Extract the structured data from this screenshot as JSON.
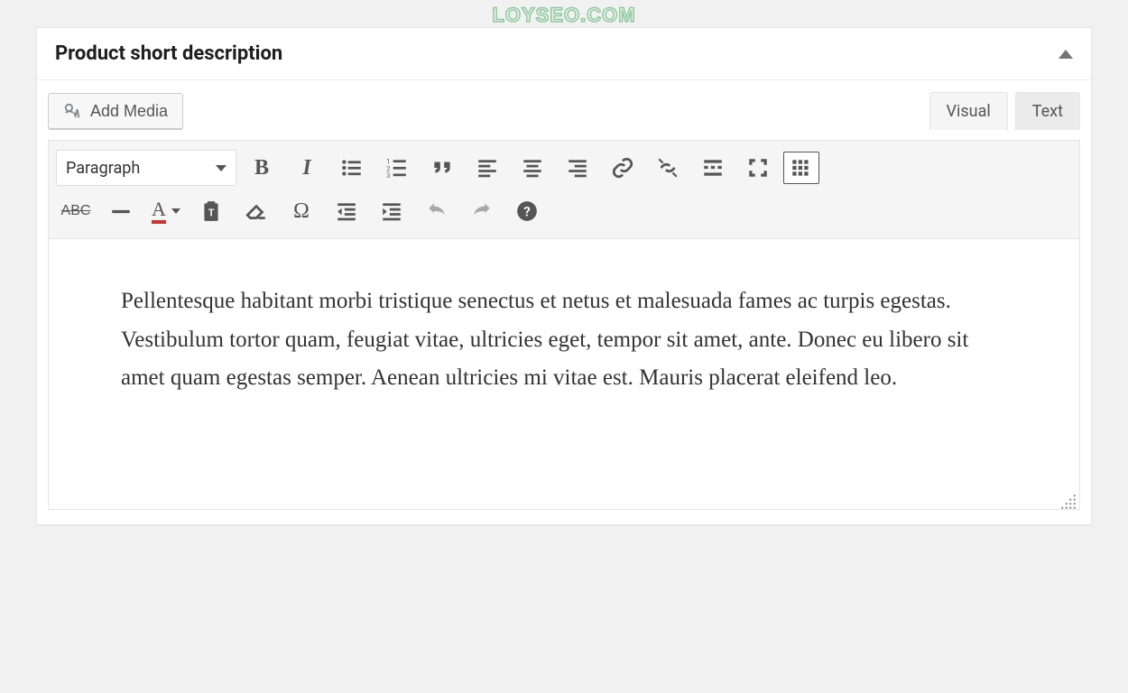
{
  "watermark": "LOYSEO.COM",
  "panel": {
    "title": "Product short description"
  },
  "media_button": {
    "label": "Add Media"
  },
  "tabs": {
    "visual": "Visual",
    "text": "Text"
  },
  "format_dropdown": {
    "selected": "Paragraph"
  },
  "toolbar_row2": {
    "strike_label": "ABC",
    "color_letter": "A",
    "special_char": "Ω"
  },
  "content": {
    "paragraph": "Pellentesque habitant morbi tristique senectus et netus et malesuada fames ac turpis egestas. Vestibulum tortor quam, feugiat vitae, ultricies eget, tempor sit amet, ante. Donec eu libero sit amet quam egestas semper. Aenean ultricies mi vitae est. Mauris placerat eleifend leo."
  }
}
